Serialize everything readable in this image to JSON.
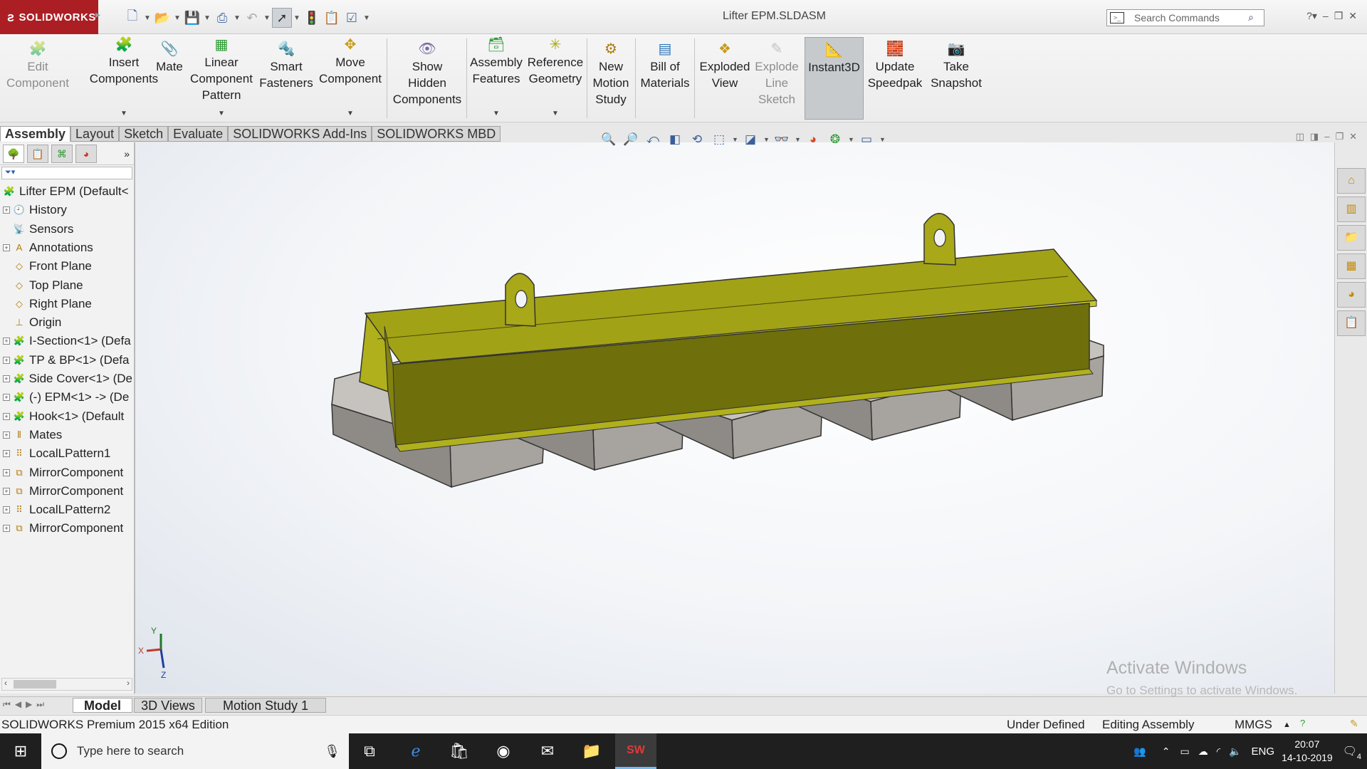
{
  "app": {
    "logo_text": "SOLIDWORKS",
    "document_title": "Lifter EPM.SLDASM",
    "search_placeholder": "Search Commands"
  },
  "command_manager": {
    "buttons": [
      {
        "label_1": "Edit",
        "label_2": "Component",
        "label_3": "",
        "enabled": false
      },
      {
        "label_1": "Insert",
        "label_2": "Components",
        "label_3": "",
        "enabled": true
      },
      {
        "label_1": "Mate",
        "label_2": "",
        "label_3": "",
        "enabled": true
      },
      {
        "label_1": "Linear",
        "label_2": "Component",
        "label_3": "Pattern",
        "enabled": true
      },
      {
        "label_1": "Smart",
        "label_2": "Fasteners",
        "label_3": "",
        "enabled": true
      },
      {
        "label_1": "Move",
        "label_2": "Component",
        "label_3": "",
        "enabled": true
      },
      {
        "label_1": "Show",
        "label_2": "Hidden",
        "label_3": "Components",
        "enabled": true
      },
      {
        "label_1": "Assembly",
        "label_2": "Features",
        "label_3": "",
        "enabled": true
      },
      {
        "label_1": "Reference",
        "label_2": "Geometry",
        "label_3": "",
        "enabled": true
      },
      {
        "label_1": "New",
        "label_2": "Motion",
        "label_3": "Study",
        "enabled": true
      },
      {
        "label_1": "Bill of",
        "label_2": "Materials",
        "label_3": "",
        "enabled": true
      },
      {
        "label_1": "Exploded",
        "label_2": "View",
        "label_3": "",
        "enabled": true
      },
      {
        "label_1": "Explode",
        "label_2": "Line",
        "label_3": "Sketch",
        "enabled": false
      },
      {
        "label_1": "Instant3D",
        "label_2": "",
        "label_3": "",
        "enabled": true
      },
      {
        "label_1": "Update",
        "label_2": "Speedpak",
        "label_3": "",
        "enabled": true
      },
      {
        "label_1": "Take",
        "label_2": "Snapshot",
        "label_3": "",
        "enabled": true
      }
    ]
  },
  "tabs": [
    "Assembly",
    "Layout",
    "Sketch",
    "Evaluate",
    "SOLIDWORKS Add-Ins",
    "SOLIDWORKS MBD"
  ],
  "feature_tree": {
    "root": "Lifter EPM  (Default<",
    "items": [
      {
        "label": "History",
        "icon": "history-icon",
        "expandable": true
      },
      {
        "label": "Sensors",
        "icon": "sensors-icon",
        "expandable": false
      },
      {
        "label": "Annotations",
        "icon": "annotations-icon",
        "expandable": true
      },
      {
        "label": "Front Plane",
        "icon": "plane-icon",
        "expandable": false
      },
      {
        "label": "Top Plane",
        "icon": "plane-icon",
        "expandable": false
      },
      {
        "label": "Right Plane",
        "icon": "plane-icon",
        "expandable": false
      },
      {
        "label": "Origin",
        "icon": "origin-icon",
        "expandable": false
      },
      {
        "label": "I-Section<1> (Defa",
        "icon": "part-icon",
        "expandable": true
      },
      {
        "label": "TP & BP<1> (Defa",
        "icon": "part-icon",
        "expandable": true
      },
      {
        "label": "Side Cover<1> (De",
        "icon": "part-icon",
        "expandable": true
      },
      {
        "label": "(-) EPM<1> -> (De",
        "icon": "part-icon",
        "expandable": true
      },
      {
        "label": "Hook<1> (Default",
        "icon": "part-icon",
        "expandable": true
      },
      {
        "label": "Mates",
        "icon": "mates-icon",
        "expandable": true
      },
      {
        "label": "LocalLPattern1",
        "icon": "pattern-icon",
        "expandable": true
      },
      {
        "label": "MirrorComponent",
        "icon": "mirror-icon",
        "expandable": true
      },
      {
        "label": "MirrorComponent",
        "icon": "mirror-icon",
        "expandable": true
      },
      {
        "label": "LocalLPattern2",
        "icon": "pattern-icon",
        "expandable": true
      },
      {
        "label": "MirrorComponent",
        "icon": "mirror-icon",
        "expandable": true
      }
    ]
  },
  "triad": {
    "y": "Y",
    "x": "X",
    "z": "Z"
  },
  "watermark": {
    "line1": "Activate Windows",
    "line2": "Go to Settings to activate Windows."
  },
  "bottom_tabs": [
    "Model",
    "3D Views",
    "Motion Study 1"
  ],
  "status_bar": {
    "edition": "SOLIDWORKS Premium 2015 x64 Edition",
    "state": "Under Defined",
    "mode": "Editing Assembly",
    "units": "MMGS"
  },
  "taskbar": {
    "search_placeholder": "Type here to search",
    "language": "ENG",
    "time": "20:07",
    "date": "14-10-2019",
    "notifications": "4"
  },
  "colors": {
    "brand_red": "#ab1f24",
    "beam_yellow": "#9a9a14",
    "block_gray": "#a9a6a1"
  }
}
